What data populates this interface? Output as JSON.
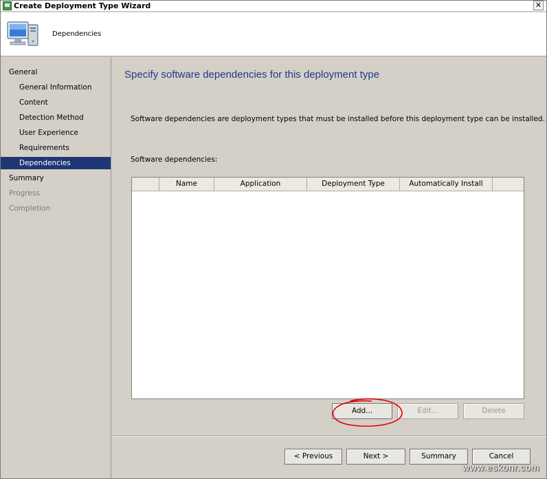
{
  "window": {
    "title": "Create Deployment Type Wizard",
    "close_glyph": "✕"
  },
  "header": {
    "title": "Dependencies",
    "icon": "computer-icon"
  },
  "nav": {
    "items": [
      {
        "label": "General",
        "level": 1,
        "state": "normal"
      },
      {
        "label": "General Information",
        "level": 2,
        "state": "normal"
      },
      {
        "label": "Content",
        "level": 2,
        "state": "normal"
      },
      {
        "label": "Detection Method",
        "level": 2,
        "state": "normal"
      },
      {
        "label": "User Experience",
        "level": 2,
        "state": "normal"
      },
      {
        "label": "Requirements",
        "level": 2,
        "state": "normal"
      },
      {
        "label": "Dependencies",
        "level": 2,
        "state": "active"
      },
      {
        "label": "Summary",
        "level": 1,
        "state": "normal"
      },
      {
        "label": "Progress",
        "level": 1,
        "state": "disabled"
      },
      {
        "label": "Completion",
        "level": 1,
        "state": "disabled"
      }
    ]
  },
  "main": {
    "heading": "Specify software dependencies for this deployment type",
    "description": "Software dependencies are deployment types that must be installed before this deployment type can be installed.",
    "dependencies_label": "Software dependencies:",
    "table": {
      "columns": [
        "",
        "Name",
        "Application",
        "Deployment Type",
        "Automatically Install",
        ""
      ],
      "rows": []
    },
    "buttons": {
      "add": "Add...",
      "edit": "Edit...",
      "delete": "Delete"
    }
  },
  "footer": {
    "previous": "< Previous",
    "next": "Next >",
    "summary": "Summary",
    "cancel": "Cancel"
  },
  "watermark": "www.eskonr.com",
  "colors": {
    "accent": "#1e3774",
    "heading": "#1e3a8a",
    "annotation": "#e00000"
  }
}
